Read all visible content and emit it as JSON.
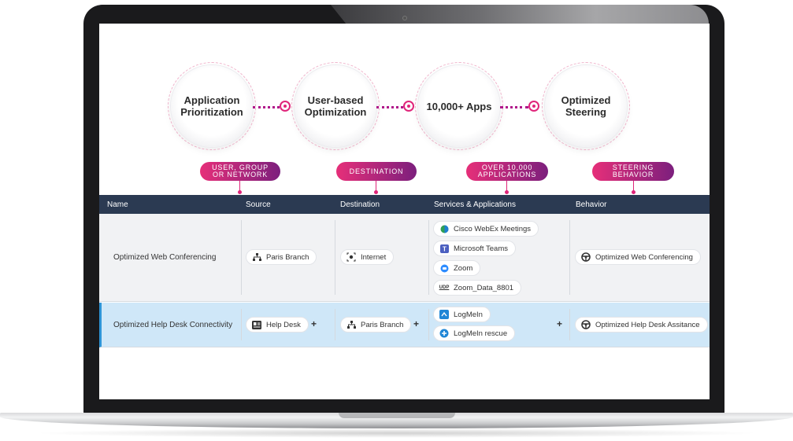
{
  "features": [
    {
      "label": "Application Prioritization"
    },
    {
      "label": "User-based Optimization"
    },
    {
      "label": "10,000+ Apps"
    },
    {
      "label": "Optimized Steering"
    }
  ],
  "tags": [
    {
      "label": "USER, GROUP OR NETWORK"
    },
    {
      "label": "DESTINATION"
    },
    {
      "label": "OVER 10,000 APPLICATIONS"
    },
    {
      "label": "STEERING BEHAVIOR"
    }
  ],
  "table": {
    "columns": [
      "Name",
      "Source",
      "Destination",
      "Services & Applications",
      "Behavior"
    ],
    "rows": [
      {
        "name": "Optimized Web Conferencing",
        "source": "Paris Branch",
        "destination": "Internet",
        "services": [
          "Cisco WebEx Meetings",
          "Microsoft Teams",
          "Zoom",
          "Zoom_Data_8801"
        ],
        "behavior": "Optimized Web Conferencing"
      },
      {
        "name": "Optimized Help Desk Connectivity",
        "source": "Help Desk",
        "destination": "Paris Branch",
        "services": [
          "LogMeIn",
          "LogMeIn rescue"
        ],
        "behavior": "Optimized Help Desk Assitance"
      }
    ],
    "add_symbol": "+"
  },
  "icons": {
    "branch": "network-branch-icon",
    "internet": "internet-icon",
    "webex": "webex-icon",
    "teams": "teams-icon",
    "zoom": "zoom-icon",
    "udp": "udp-icon",
    "steering": "steering-wheel-icon",
    "helpdesk": "helpdesk-icon",
    "logmein": "logmein-icon",
    "rescue": "logmein-rescue-icon"
  },
  "colors": {
    "accent_pink": "#e0257a",
    "accent_purple": "#7c1f7d",
    "header_bg": "#2b3a52",
    "selected_row_bg": "#cfe7f8",
    "selected_row_border": "#2e94d6"
  }
}
